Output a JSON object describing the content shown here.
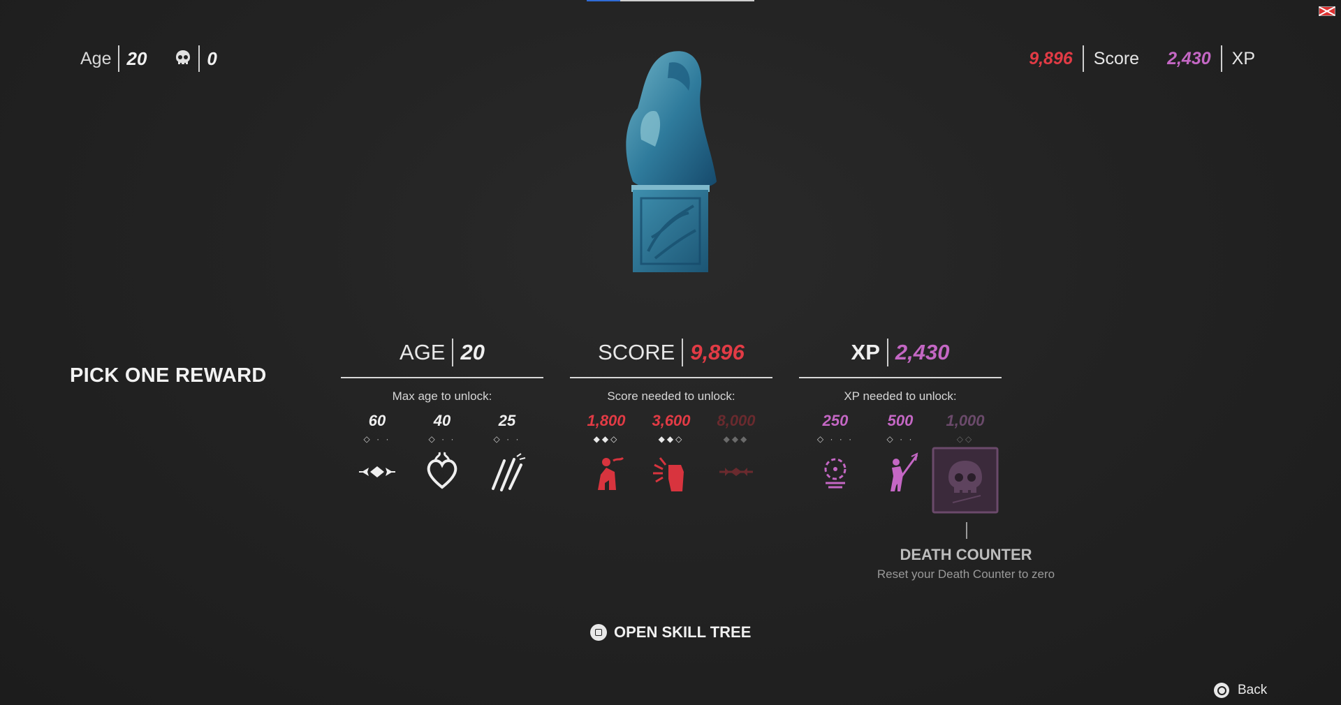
{
  "colors": {
    "score_red": "#e23b45",
    "xp_purple": "#c467c4",
    "white": "#efefef"
  },
  "hud_left": {
    "age_label": "Age",
    "age_value": "20",
    "deaths_icon": "skull-icon",
    "deaths_value": "0"
  },
  "hud_right": {
    "score_value": "9,896",
    "score_label": "Score",
    "xp_value": "2,430",
    "xp_label": "XP"
  },
  "title": "PICK ONE REWARD",
  "columns": [
    {
      "head_label": "AGE",
      "head_value": "20",
      "sub": "Max age to unlock:",
      "tiers": [
        {
          "num": "60",
          "dots": "◇ · ·",
          "icon": "diamond-wings-icon"
        },
        {
          "num": "40",
          "dots": "◇ · ·",
          "icon": "flaming-heart-icon"
        },
        {
          "num": "25",
          "dots": "◇ · ·",
          "icon": "slashes-icon"
        }
      ]
    },
    {
      "head_label": "SCORE",
      "head_value": "9,896",
      "sub": "Score needed to unlock:",
      "tiers": [
        {
          "num": "1,800",
          "dots": "◆◆◇",
          "icon": "crouching-figure-icon"
        },
        {
          "num": "3,600",
          "dots": "◆◆◇",
          "icon": "fist-burst-icon"
        },
        {
          "num": "8,000",
          "dots": "◆◆◆",
          "icon": "locked-diamond-icon"
        }
      ]
    },
    {
      "head_label": "XP",
      "head_value": "2,430",
      "sub": "XP needed to unlock:",
      "tiers": [
        {
          "num": "250",
          "dots": "◇ · · ·",
          "icon": "target-icon"
        },
        {
          "num": "500",
          "dots": "◇ · ·",
          "icon": "spear-figure-icon"
        },
        {
          "num": "1,000",
          "dots": "◇◇",
          "icon": "skull-frame-icon"
        }
      ]
    }
  ],
  "tooltip": {
    "title": "DEATH COUNTER",
    "desc": "Reset your Death Counter to zero"
  },
  "skill_tree_label": "OPEN SKILL TREE",
  "back_label": "Back"
}
